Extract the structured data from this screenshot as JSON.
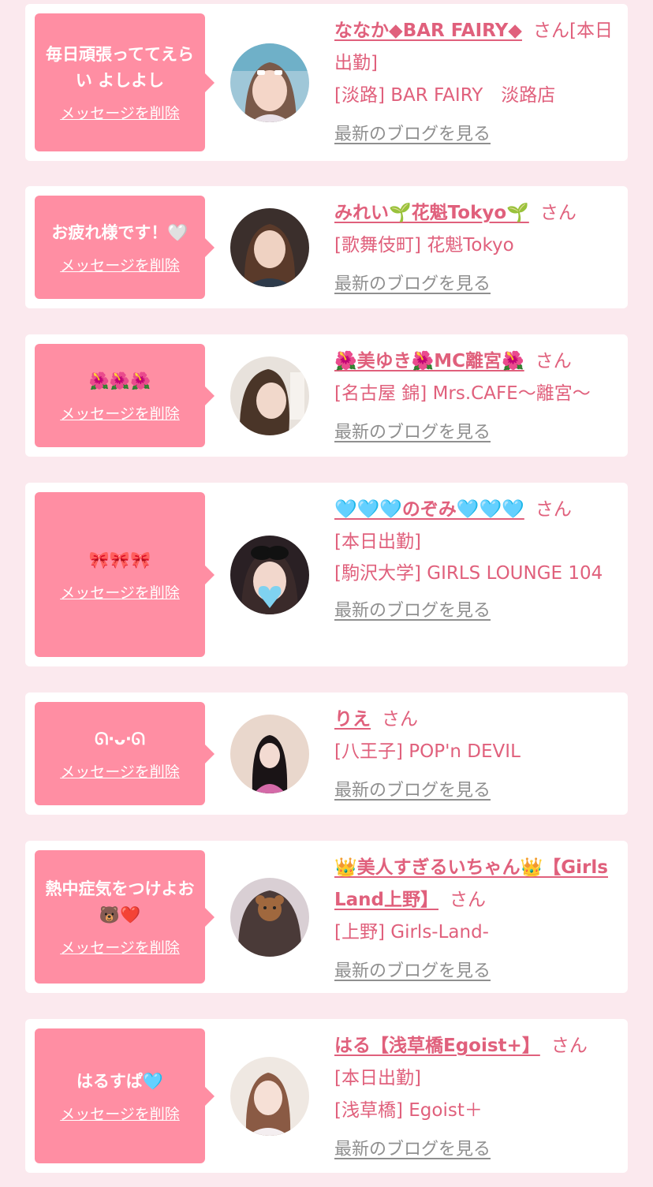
{
  "delete_label": "メッセージを削除",
  "blog_label": "最新のブログを見る",
  "san_label": "さん",
  "cards": [
    {
      "message": "毎日頑張っててえらい よしよし",
      "name": "ななか◆BAR FAIRY◆",
      "name_suffix": "[本日出勤]",
      "extra": "",
      "area_shop": "[淡路] BAR FAIRY　淡路店"
    },
    {
      "message": "お疲れ様です！🤍",
      "name": "みれい🌱花魁Tokyo🌱",
      "name_suffix": "",
      "extra": "",
      "area_shop": "[歌舞伎町] 花魁Tokyo"
    },
    {
      "message": "🌺🌺🌺",
      "name": "🌺美ゆき🌺MC離宮🌺",
      "name_suffix": "",
      "extra": "",
      "area_shop": "[名古屋 錦] Mrs.CAFE～離宮～"
    },
    {
      "message": "🎀🎀🎀",
      "name": "🩵🩵🩵のぞみ🩵🩵🩵",
      "name_suffix": "",
      "extra": "[本日出勤]",
      "area_shop": "[駒沢大学] GIRLS LOUNGE 104"
    },
    {
      "message": "ᘏ‧ᴗ‧ᘏ",
      "name": "りえ",
      "name_suffix": "",
      "extra": "",
      "area_shop": "[八王子] POP'n DEVIL"
    },
    {
      "message": "熱中症気をつけよお🐻❤️",
      "name": "👑美人すぎるいちゃん👑【Girls Land上野】",
      "name_suffix": "",
      "extra": "",
      "area_shop": "[上野] Girls-Land-"
    },
    {
      "message": "はるすぱ🩵",
      "name": "はる【浅草橋Egoist+】",
      "name_suffix": "",
      "extra": "[本日出勤]",
      "area_shop": "[浅草橋] Egoist＋"
    }
  ],
  "colors": {
    "background": "#fbe9ee",
    "bubble": "#ff8ea3",
    "name_text": "#e0607c",
    "blog_link": "#8f8f8f"
  }
}
